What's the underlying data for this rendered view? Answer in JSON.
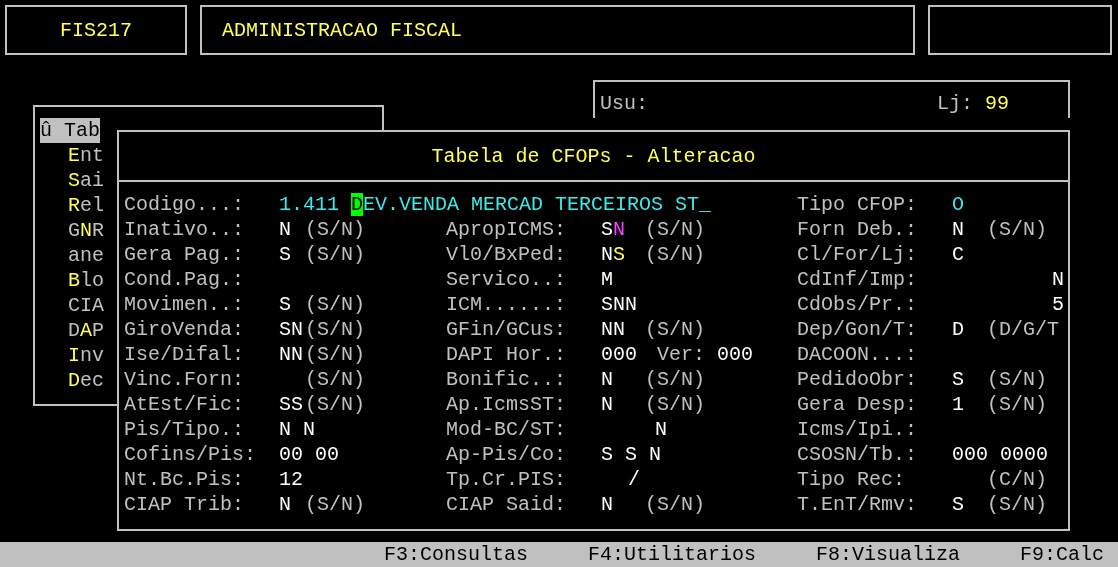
{
  "header": {
    "program": "FIS217",
    "title": "ADMINISTRACAO FISCAL"
  },
  "session": {
    "user_label": "Usu:",
    "store_label": "Lj:",
    "store": "99"
  },
  "menu": {
    "items": [
      {
        "before": "û Tab",
        "selected": true
      },
      {
        "key": "E",
        "after": "nt",
        "selected": false
      },
      {
        "key": "S",
        "after": "ai",
        "selected": false
      },
      {
        "key": "R",
        "after": "el",
        "selected": false
      },
      {
        "before": "G",
        "key": "N",
        "after": "R",
        "selected": false
      },
      {
        "before": "ane",
        "selected": false
      },
      {
        "key": "B",
        "after": "lo",
        "selected": false
      },
      {
        "before": "CIA",
        "selected": false
      },
      {
        "before": "D",
        "key": "A",
        "after": "P",
        "selected": false
      },
      {
        "key": "I",
        "after": "nv",
        "selected": false
      },
      {
        "key": "D",
        "after": "ec",
        "selected": false
      }
    ]
  },
  "dialog": {
    "title": "Tabela de CFOPs - Alteracao",
    "code": {
      "label": "Codigo...:",
      "value": "1.411",
      "cursor": "D",
      "description": "EV.VENDA MERCAD TERCEIROS ST_"
    },
    "type": {
      "label": "Tipo CFOP:",
      "value": "O"
    },
    "columns": [
      [
        {
          "label": "Inativo..:",
          "value": "N",
          "hint": "(S/N)"
        },
        {
          "label": "Gera Pag.:",
          "value": "S",
          "hint": "(S/N)"
        },
        {
          "label": "Cond.Pag.:"
        },
        {
          "label": "Movimen..:",
          "value": "S",
          "hint": "(S/N)"
        },
        {
          "label": "GiroVenda:",
          "value": "SN",
          "hint": "(S/N)"
        },
        {
          "label": "Ise/Difal:",
          "value": "NN",
          "hint": "(S/N)"
        },
        {
          "label": "Vinc.Forn:",
          "hint": "(S/N)"
        },
        {
          "label": "AtEst/Fic:",
          "value": "SS",
          "hint": "(S/N)"
        },
        {
          "label": "Pis/Tipo.:",
          "value": "N N"
        },
        {
          "label": "Cofins/Pis:",
          "value": "00 00"
        },
        {
          "label": "Nt.Bc.Pis:",
          "value": "12"
        },
        {
          "label": "CIAP Trib:",
          "value": "N",
          "hint": "(S/N)"
        }
      ],
      [
        {
          "label": "ApropICMS:",
          "value": "S",
          "accent": {
            "text": "N",
            "color": "#ff44ff"
          },
          "hint": "(S/N)"
        },
        {
          "label": "Vl0/BxPed:",
          "value": "N",
          "accent": {
            "text": "S",
            "color": "#ffff55"
          },
          "hint": "(S/N)"
        },
        {
          "label": "Servico..:",
          "value": "M"
        },
        {
          "label": "ICM......:",
          "value": "SNN"
        },
        {
          "label": "GFin/GCus:",
          "value": "NN",
          "hint": "(S/N)"
        },
        {
          "label": "DAPI Hor.:",
          "value": "000",
          "sublabel": "Ver:",
          "subvalue": "000"
        },
        {
          "label": "Bonific..:",
          "value": "N",
          "hint": "(S/N)"
        },
        {
          "label": "Ap.IcmsST:",
          "value": "N",
          "hint": "(S/N)"
        },
        {
          "label": "Mod-BC/ST:",
          "value": "N",
          "kind": "right"
        },
        {
          "label": "Ap-Pis/Co:",
          "value": "S S N"
        },
        {
          "label": "Tp.Cr.PIS:",
          "value": "/",
          "kind": "center"
        },
        {
          "label": "CIAP Said:",
          "value": "N",
          "hint": "(S/N)"
        }
      ],
      [
        {
          "label": "Forn Deb.:",
          "value": "N",
          "hint": "(S/N)"
        },
        {
          "label": "Cl/For/Lj:",
          "value": "C"
        },
        {
          "label": "CdInf/Imp:",
          "value": "N",
          "kind": "right"
        },
        {
          "label": "CdObs/Pr.:",
          "value": "5",
          "kind": "right"
        },
        {
          "label": "Dep/Gon/T:",
          "value": "D",
          "hint": "(D/G/T"
        },
        {
          "label": "DACOON...:"
        },
        {
          "label": "PedidoObr:",
          "value": "S",
          "hint": "(S/N)"
        },
        {
          "label": "Gera Desp:",
          "value": "1",
          "hint": "(S/N)"
        },
        {
          "label": "Icms/Ipi.:"
        },
        {
          "label": "CSOSN/Tb.:",
          "value": "000 0000"
        },
        {
          "label": "Tipo Rec:",
          "hint": "(C/N)"
        },
        {
          "label": "T.EnT/Rmv:",
          "value": "S",
          "hint": "(S/N)"
        }
      ]
    ]
  },
  "status_bar": [
    "F3:Consultas",
    "F4:Utilitarios",
    "F8:Visualiza",
    "F9:Calc"
  ]
}
